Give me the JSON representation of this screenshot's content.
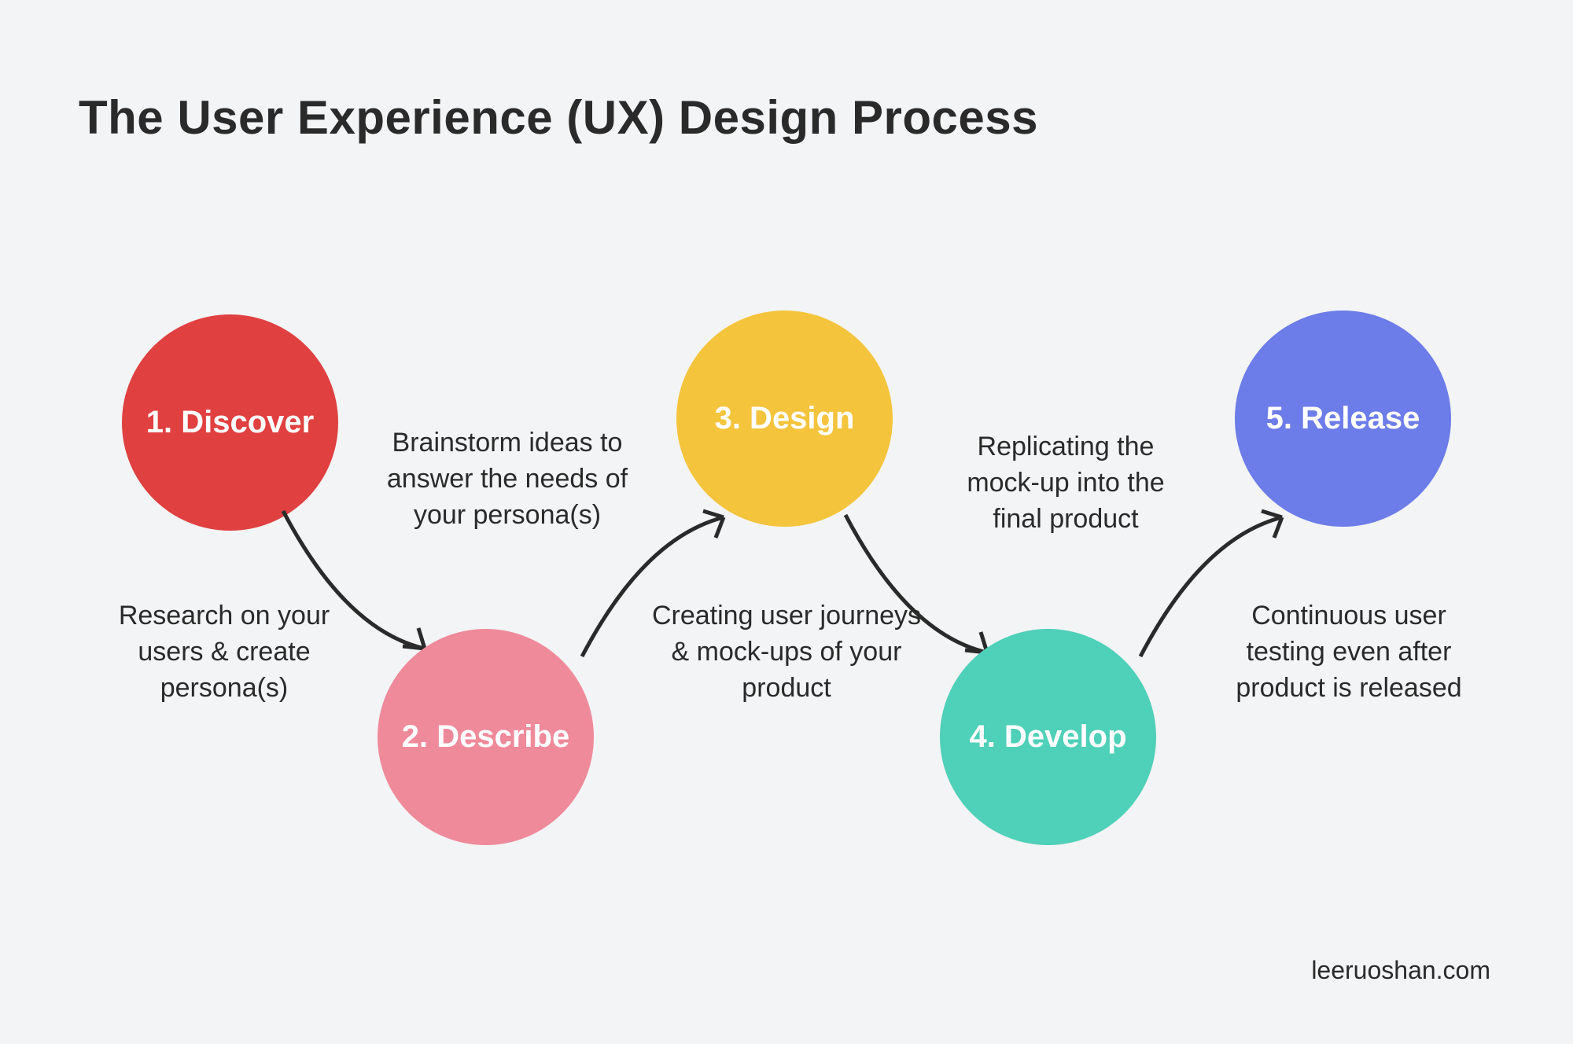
{
  "title": "The User Experience (UX) Design Process",
  "credit": "leeruoshan.com",
  "colors": {
    "discover": "#e04040",
    "describe": "#ef8a9b",
    "design": "#f4c43c",
    "develop": "#4fd0b8",
    "release": "#6c7ce8",
    "text": "#2a2a2a",
    "bg": "#f3f4f5"
  },
  "steps": [
    {
      "id": "discover",
      "label": "1. Discover",
      "caption": "Research on your users & create persona(s)"
    },
    {
      "id": "describe",
      "label": "2. Describe",
      "caption": "Brainstorm ideas to answer the needs of your persona(s)"
    },
    {
      "id": "design",
      "label": "3. Design",
      "caption": "Creating  user journeys & mock-ups of your product"
    },
    {
      "id": "develop",
      "label": "4. Develop",
      "caption": "Replicating the mock-up into the final product"
    },
    {
      "id": "release",
      "label": "5. Release",
      "caption": "Continuous user testing even after product is released"
    }
  ]
}
